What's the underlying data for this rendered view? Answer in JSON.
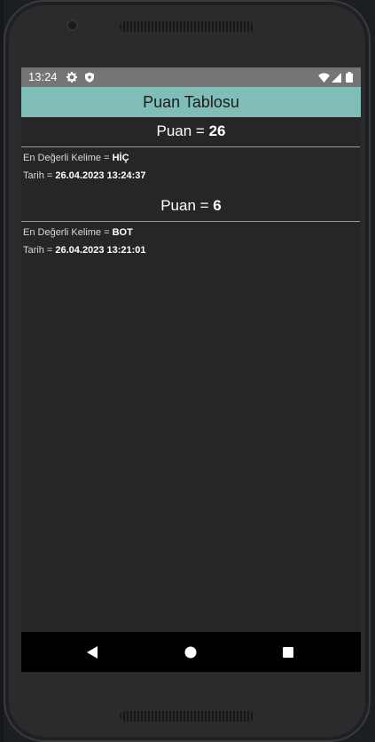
{
  "status_bar": {
    "time": "13:24",
    "icons": [
      "settings-gear-icon",
      "shield-icon",
      "wifi-icon",
      "signal-icon",
      "battery-icon"
    ]
  },
  "app_bar": {
    "title": "Puan Tablosu",
    "color": "#7fbdb6"
  },
  "entries": [
    {
      "score_label": "Puan = ",
      "score_value": "26",
      "word_label": "En Değerli Kelime = ",
      "word_value": "HİÇ",
      "date_label": "Tarih = ",
      "date_value": "26.04.2023 13:24:37"
    },
    {
      "score_label": "Puan = ",
      "score_value": "6",
      "word_label": "En Değerli Kelime = ",
      "word_value": "BOT",
      "date_label": "Tarih = ",
      "date_value": "26.04.2023 13:21:01"
    }
  ],
  "nav_bar": {
    "buttons": [
      "back-triangle-icon",
      "home-circle-icon",
      "recents-square-icon"
    ]
  }
}
